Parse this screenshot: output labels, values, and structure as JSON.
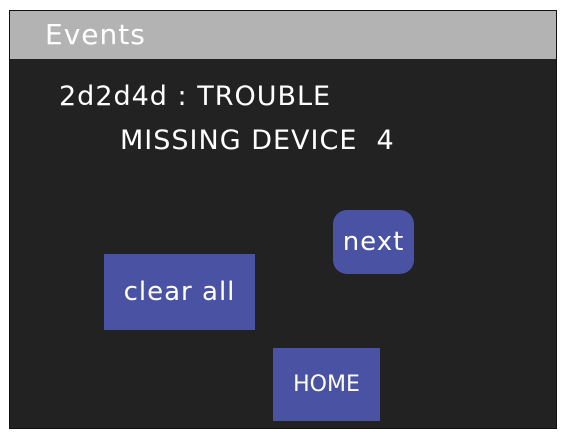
{
  "header": {
    "title": "Events"
  },
  "event": {
    "line1": "2d2d4d : TROUBLE",
    "line2": "MISSING DEVICE  4"
  },
  "buttons": {
    "next_label": "next",
    "clear_all_label": "clear all",
    "home_label": "HOME"
  },
  "colors": {
    "background": "#222222",
    "title_bar": "#b3b3b3",
    "button": "#4a52a3",
    "text": "#ffffff"
  }
}
